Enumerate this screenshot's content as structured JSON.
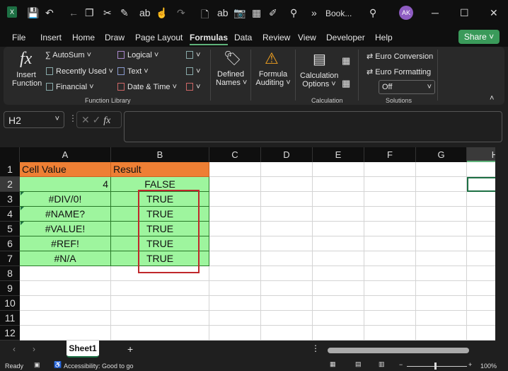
{
  "titlebar": {
    "title": "Book...",
    "avatar": "AK",
    "more": "»"
  },
  "menu": {
    "tabs": [
      "File",
      "Insert",
      "Home",
      "Draw",
      "Page Layout",
      "Formulas",
      "Data",
      "Review",
      "View",
      "Developer",
      "Help"
    ],
    "active": "Formulas",
    "share": "Share"
  },
  "ribbon": {
    "insert_function": [
      "Insert",
      "Function"
    ],
    "autosum": "AutoSum",
    "recently_used": "Recently Used",
    "financial": "Financial",
    "logical": "Logical",
    "text": "Text",
    "date_time": "Date & Time",
    "defined_names": [
      "Defined",
      "Names"
    ],
    "formula_auditing": [
      "Formula",
      "Auditing"
    ],
    "calculation_options": [
      "Calculation",
      "Options"
    ],
    "euro_conversion": "Euro Conversion",
    "euro_formatting": "Euro Formatting",
    "solutions_select": "Off",
    "groups": {
      "function_library": "Function Library",
      "calculation": "Calculation",
      "solutions": "Solutions"
    }
  },
  "formula_bar": {
    "name_box": "H2",
    "value": ""
  },
  "grid": {
    "columns": [
      "A",
      "B",
      "C",
      "D",
      "E",
      "F",
      "G",
      "H"
    ],
    "rows": [
      "1",
      "2",
      "3",
      "4",
      "5",
      "6",
      "7",
      "8",
      "9",
      "10",
      "11",
      "12"
    ],
    "cells": [
      [
        "Cell Value",
        "Result"
      ],
      [
        "4",
        "FALSE"
      ],
      [
        "#DIV/0!",
        "TRUE"
      ],
      [
        "#NAME?",
        "TRUE"
      ],
      [
        "#VALUE!",
        "TRUE"
      ],
      [
        "#REF!",
        "TRUE"
      ],
      [
        "#N/A",
        "TRUE"
      ]
    ],
    "selected": "H2",
    "colors": {
      "header": "#ee7f34",
      "data": "#9ef59e",
      "highlight": "#c0282c"
    }
  },
  "sheets": {
    "tabs": [
      "Sheet1"
    ],
    "add": "+"
  },
  "status": {
    "ready": "Ready",
    "accessibility": "Accessibility: Good to go",
    "zoom": "100%"
  }
}
